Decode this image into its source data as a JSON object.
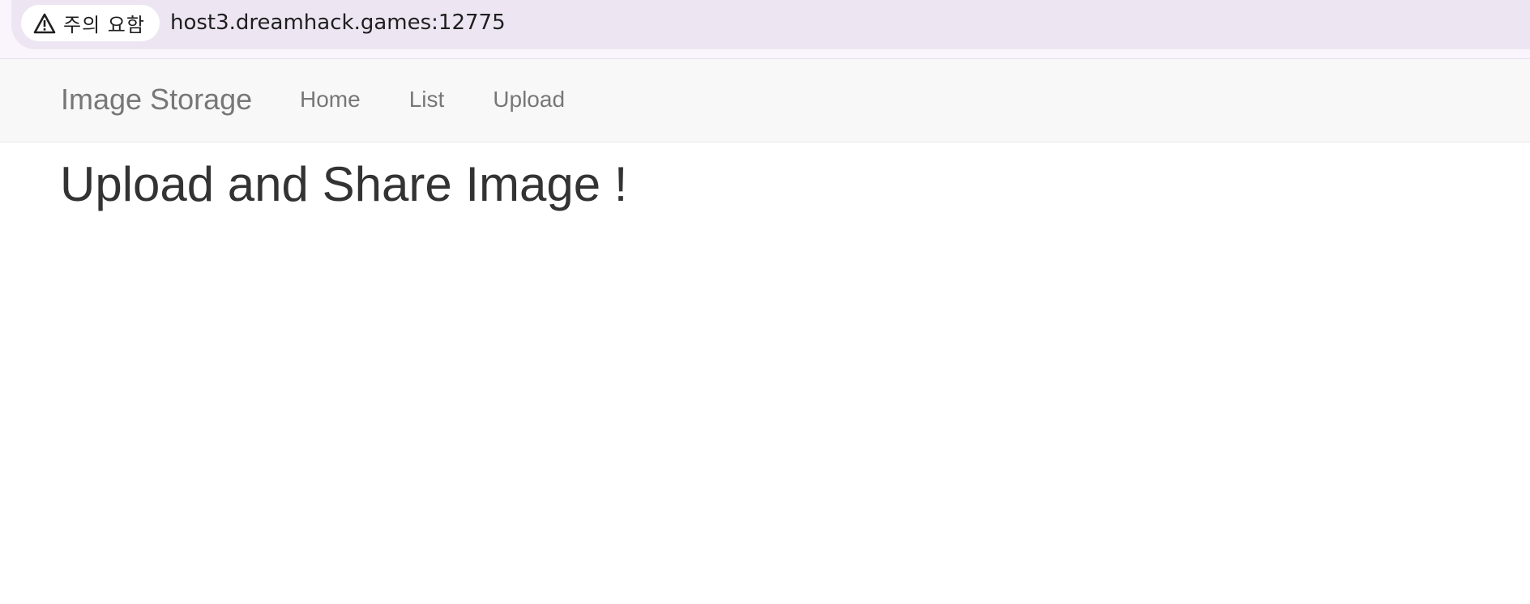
{
  "browser": {
    "security_chip_label": "주의 요함",
    "url": "host3.dreamhack.games:12775",
    "security_icon": "warning-icon"
  },
  "navbar": {
    "brand": "Image Storage",
    "links": [
      "Home",
      "List",
      "Upload"
    ]
  },
  "main": {
    "heading": "Upload and Share Image !"
  },
  "colors": {
    "nav_text": "#777777",
    "heading_text": "#333333",
    "navbar_bg": "#f8f8f8",
    "omnibox_bg": "#ede6f2"
  }
}
